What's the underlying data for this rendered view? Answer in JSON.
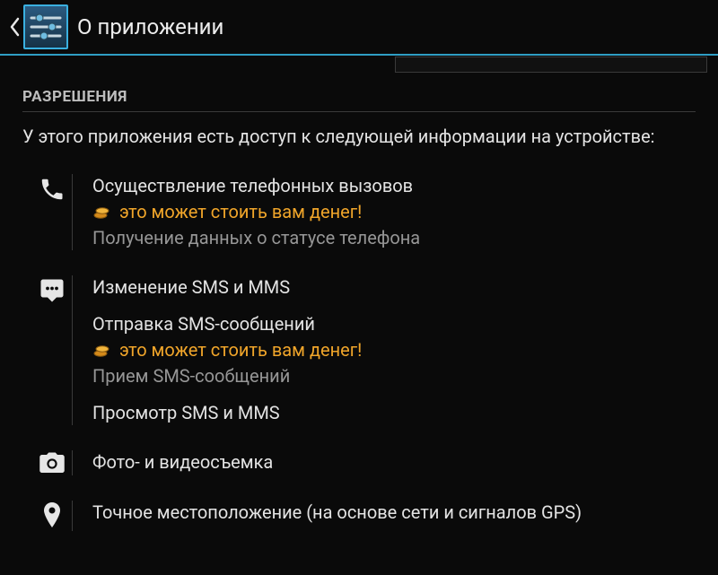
{
  "header": {
    "title": "О приложении"
  },
  "section": {
    "heading": "РАЗРЕШЕНИЯ",
    "intro": "У этого приложения есть доступ к следующей информации на устройстве:"
  },
  "perms": {
    "phone": {
      "l1": "Осуществление телефонных вызовов",
      "warn": "это может стоить вам денег!",
      "l2": "Получение данных о статусе телефона"
    },
    "sms": {
      "l1": "Изменение SMS и MMS",
      "l2": "Отправка SMS-сообщений",
      "warn": "это может стоить вам денег!",
      "l3": "Прием SMS-сообщений",
      "l4": "Просмотр SMS и MMS"
    },
    "camera": {
      "l1": "Фото- и видеосъемка"
    },
    "location": {
      "l1": "Точное местоположение (на основе сети и сигналов GPS)"
    }
  }
}
